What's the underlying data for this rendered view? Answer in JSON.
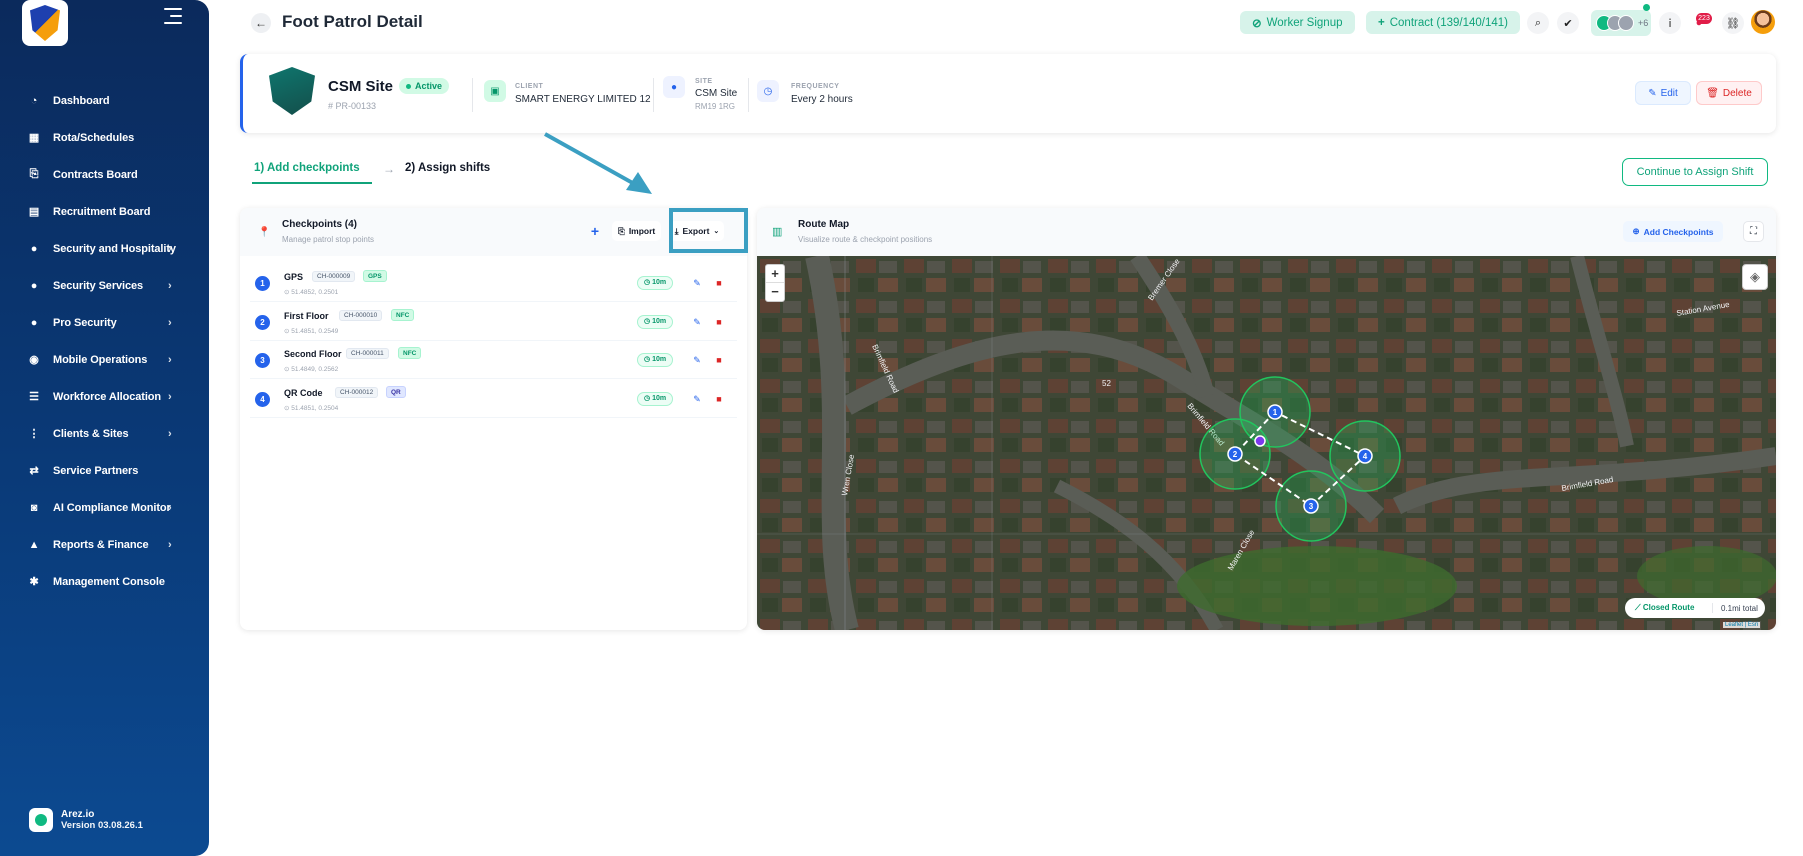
{
  "sidebar": {
    "items": [
      {
        "label": "Dashboard",
        "icon": "dashboard-icon",
        "chevron": false
      },
      {
        "label": "Rota/Schedules",
        "icon": "calendar-icon",
        "chevron": false
      },
      {
        "label": "Contracts Board",
        "icon": "contract-icon",
        "chevron": false
      },
      {
        "label": "Recruitment Board",
        "icon": "clipboard-icon",
        "chevron": false
      },
      {
        "label": "Security and Hospitality",
        "icon": "user-icon",
        "chevron": true
      },
      {
        "label": "Security Services",
        "icon": "user-icon",
        "chevron": true
      },
      {
        "label": "Pro Security",
        "icon": "user-icon",
        "chevron": true
      },
      {
        "label": "Mobile Operations",
        "icon": "car-icon",
        "chevron": true
      },
      {
        "label": "Workforce Allocation",
        "icon": "list-icon",
        "chevron": true
      },
      {
        "label": "Clients & Sites",
        "icon": "sites-icon",
        "chevron": true
      },
      {
        "label": "Service Partners",
        "icon": "handshake-icon",
        "chevron": false
      },
      {
        "label": "AI Compliance Monitor",
        "icon": "robot-icon",
        "chevron": true
      },
      {
        "label": "Reports & Finance",
        "icon": "chart-icon",
        "chevron": true
      },
      {
        "label": "Management Console",
        "icon": "gears-icon",
        "chevron": false
      }
    ],
    "footer": {
      "app_name": "Arez.io",
      "version": "Version 03.08.26.1"
    }
  },
  "header": {
    "title": "Foot Patrol Detail",
    "worker_signup": "Worker Signup",
    "contract": "Contract (139/140/141)",
    "avatars_more": "+6",
    "notifications_count": "223"
  },
  "site": {
    "name": "CSM Site",
    "status": "Active",
    "code": "PR-00133",
    "client_label": "CLIENT",
    "client_value": "SMART ENERGY LIMITED 12",
    "site_label": "SITE",
    "site_value": "CSM Site",
    "site_postcode": "RM19 1RG",
    "frequency_label": "FREQUENCY",
    "frequency_value": "Every 2 hours",
    "edit_label": "Edit",
    "delete_label": "Delete"
  },
  "steps": {
    "step1": "1) Add checkpoints",
    "step2": "2) Assign shifts",
    "continue": "Continue to Assign Shift"
  },
  "checkpoints": {
    "title": "Checkpoints (4)",
    "subtitle": "Manage patrol stop points",
    "import_label": "Import",
    "export_label": "Export",
    "items": [
      {
        "num": "1",
        "name": "GPS",
        "code": "CH-000009",
        "type": "GPS",
        "type_style": "green",
        "coords": "51.4852, 0.2501",
        "radius": "10m"
      },
      {
        "num": "2",
        "name": "First Floor",
        "code": "CH-000010",
        "type": "NFC",
        "type_style": "green",
        "coords": "51.4851, 0.2549",
        "radius": "10m"
      },
      {
        "num": "3",
        "name": "Second Floor",
        "code": "CH-000011",
        "type": "NFC",
        "type_style": "green",
        "coords": "51.4849, 0.2562",
        "radius": "10m"
      },
      {
        "num": "4",
        "name": "QR Code",
        "code": "CH-000012",
        "type": "QR",
        "type_style": "blue",
        "coords": "51.4851, 0.2504",
        "radius": "10m"
      }
    ]
  },
  "route_map": {
    "title": "Route Map",
    "subtitle": "Visualize route & checkpoint positions",
    "add_label": "Add Checkpoints",
    "zoom_in": "+",
    "zoom_out": "−",
    "legend_route": "Closed Route",
    "legend_total": "0.1mi total",
    "attribution": "Leaflet | Esri",
    "street_labels": [
      "Brimfield Road",
      "Bremer Close",
      "Brimfield Road",
      "Maren Close",
      "Wren Close",
      "Station Avenue",
      "52",
      "Brimfield Road"
    ],
    "markers": [
      "1",
      "2",
      "3",
      "4"
    ]
  },
  "colors": {
    "accent": "#10a37a",
    "primary": "#2563eb",
    "danger": "#dc2626",
    "sidebar": "#0b2a5c",
    "highlight": "#3b9fc2"
  }
}
